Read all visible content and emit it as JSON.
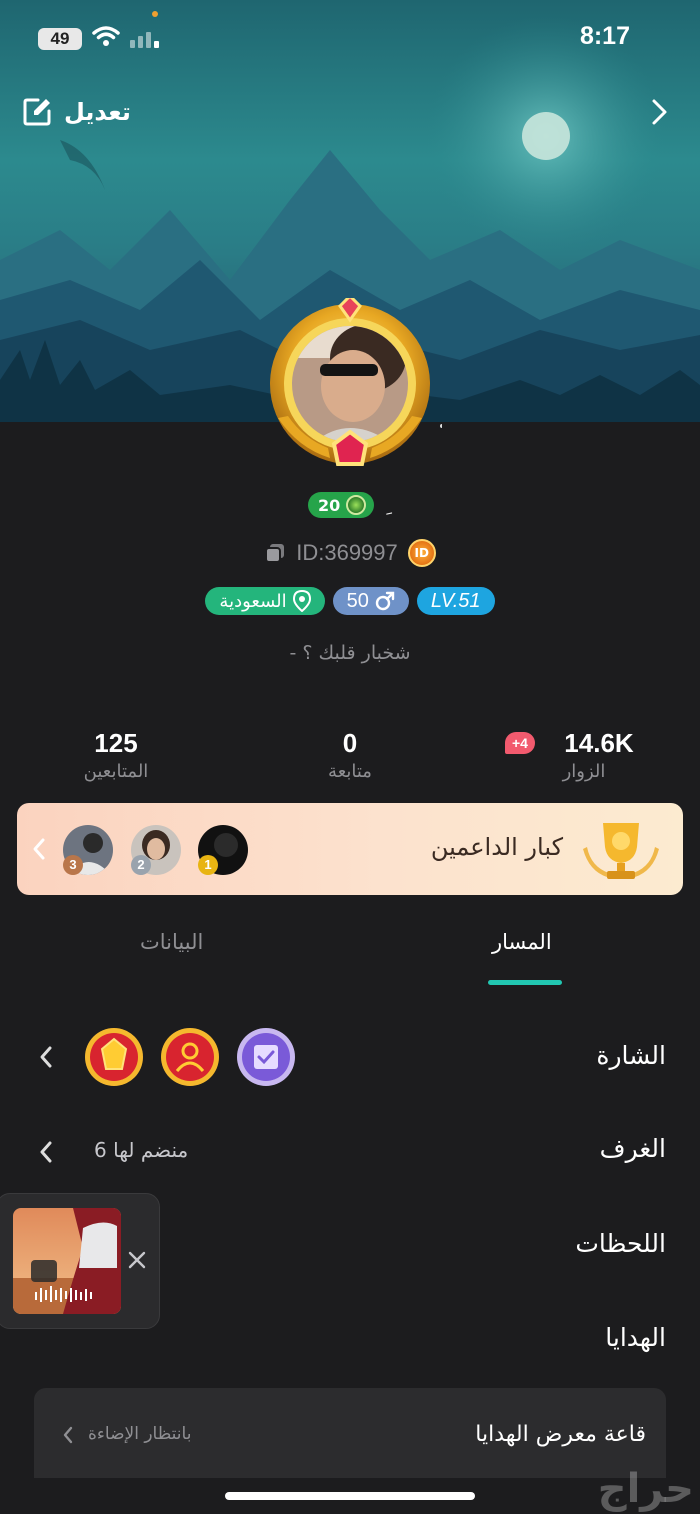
{
  "status_bar": {
    "time": "8:17",
    "battery": "49"
  },
  "header": {
    "edit_label": "تعديل"
  },
  "profile": {
    "level_badge": "20",
    "level_mark": "ﹺ",
    "id_text": "ID:369997",
    "id_badge": "ID",
    "user_level": "LV.51",
    "age": "50",
    "country": "السعودية",
    "bio": "- شخبار قلبك ؟"
  },
  "stats": {
    "visitors": {
      "value": "14.6K",
      "label": "الزوار",
      "badge": "+4"
    },
    "following": {
      "value": "0",
      "label": "متابعة"
    },
    "followers": {
      "value": "125",
      "label": "المتابعين"
    }
  },
  "supporters": {
    "title": "كبار الداعمين",
    "ranks": [
      "1",
      "2",
      "3"
    ]
  },
  "tabs": [
    {
      "label": "المسار",
      "active": true
    },
    {
      "label": "البيانات",
      "active": false
    }
  ],
  "sections": {
    "badges_title": "الشارة",
    "rooms_title": "الغرف",
    "rooms_value": "6 منضم لها",
    "moments_title": "اللحظات",
    "gifts_title": "الهدايا"
  },
  "gift_hall": {
    "title": "قاعة معرض الهدايا",
    "status": "بانتظار الإضاءة"
  },
  "watermark": "حراج",
  "colors": {
    "accent": "#22c7b2",
    "level_green": "#26a44a",
    "lv_blue": "#1ea5e0",
    "age_blue": "#6f92c8",
    "country_green": "#24b57c",
    "visitor_badge": "#f25a6e"
  }
}
